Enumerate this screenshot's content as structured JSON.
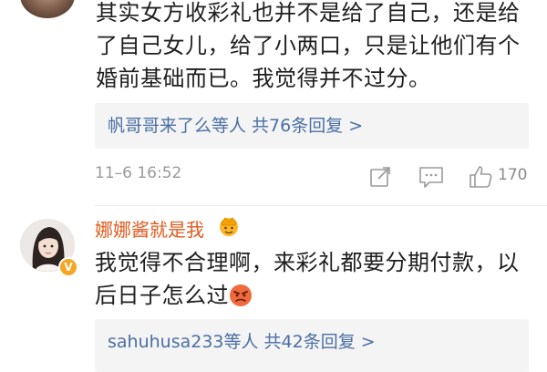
{
  "comment1": {
    "lines": [
      "其实女方收彩礼也并不是给了自己，还是给",
      "了自己女儿，给了小两口，只是让他们有个",
      "婚前基础而已。我觉得并不过分。"
    ],
    "replies_link": "帆哥哥来了么等人  共76条回复 >",
    "timestamp": "11–6 16:52",
    "like_count": "170"
  },
  "comment2": {
    "username": "娜娜酱就是我",
    "lines": [
      "我觉得不合理啊，来彩礼都要分期付款，以",
      "后日子怎么过"
    ],
    "replies_link": "sahuhusa233等人  共42条回复 >"
  },
  "colors": {
    "link_blue": "#4a6fa5",
    "username_orange": "#e05a1c",
    "meta_gray": "#9a9a9a",
    "reply_bg": "#f4f4f4"
  },
  "icons": [
    "share-icon",
    "comment-icon",
    "like-icon",
    "crown-icon",
    "angry-emoji-icon",
    "verified-badge-icon"
  ]
}
